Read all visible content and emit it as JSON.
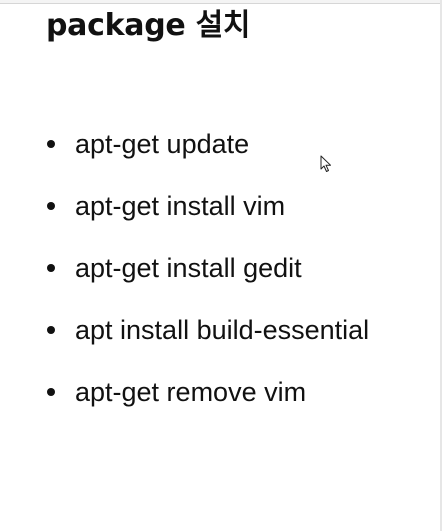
{
  "slide": {
    "title": "package 설치",
    "bullets": [
      "apt-get update",
      "apt-get install vim",
      "apt-get install gedit",
      "apt install build-essential",
      "apt-get remove vim"
    ]
  },
  "cursor": {
    "icon": "mouse-pointer-icon"
  },
  "colors": {
    "text": "#111111",
    "background": "#ffffff"
  }
}
